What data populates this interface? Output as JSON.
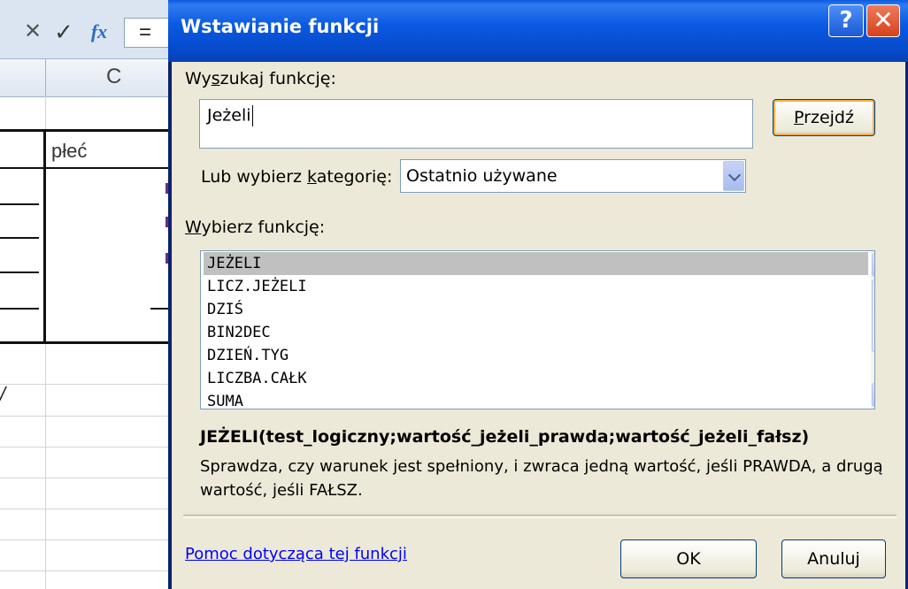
{
  "excel": {
    "formula_bar": {
      "cancel": "✕",
      "enter": "✓",
      "fx": "fx",
      "value": "="
    },
    "column_header": "C",
    "cell_c_header": "płeć",
    "partial_mark": "/"
  },
  "dialog": {
    "title": "Wstawianie funkcji",
    "help_btn": "?",
    "close_btn": "✕",
    "search": {
      "label_a": "Wy",
      "label_key": "s",
      "label_b": "zukaj funkcję:",
      "value": "Jeżeli"
    },
    "go_button": {
      "key": "P",
      "rest": "rzejdź"
    },
    "category": {
      "label_a": "Lub wybierz ",
      "label_key": "k",
      "label_b": "ategorię:",
      "value": "Ostatnio używane"
    },
    "list_label": {
      "key": "W",
      "rest": "ybierz funkcję:"
    },
    "functions": [
      "JEŻELI",
      "LICZ.JEŻELI",
      "DZIŚ",
      "BIN2DEC",
      "DZIEŃ.TYG",
      "LICZBA.CAŁK",
      "SUMA"
    ],
    "selected_function": "JEŻELI",
    "signature": "JEŻELI(test_logiczny;wartość_jeżeli_prawda;wartość_jeżeli_fałsz)",
    "description": "Sprawdza, czy warunek jest spełniony, i zwraca jedną wartość, jeśli PRAWDA, a drugą wartość, jeśli FAŁSZ.",
    "help_link": "Pomoc dotycząca tej funkcji",
    "ok": "OK",
    "cancel": "Anuluj"
  },
  "colors": {
    "title_bar": "#0a5ae2",
    "dialog_face": "#ece9d8",
    "link": "#0000ff",
    "selection": "#c0c0c0",
    "close": "#d7411c"
  },
  "icons": [
    "cancel-icon",
    "enter-check-icon",
    "fx-icon",
    "help-icon",
    "close-icon",
    "chevron-down-icon",
    "scroll-up-icon",
    "scroll-down-icon"
  ]
}
